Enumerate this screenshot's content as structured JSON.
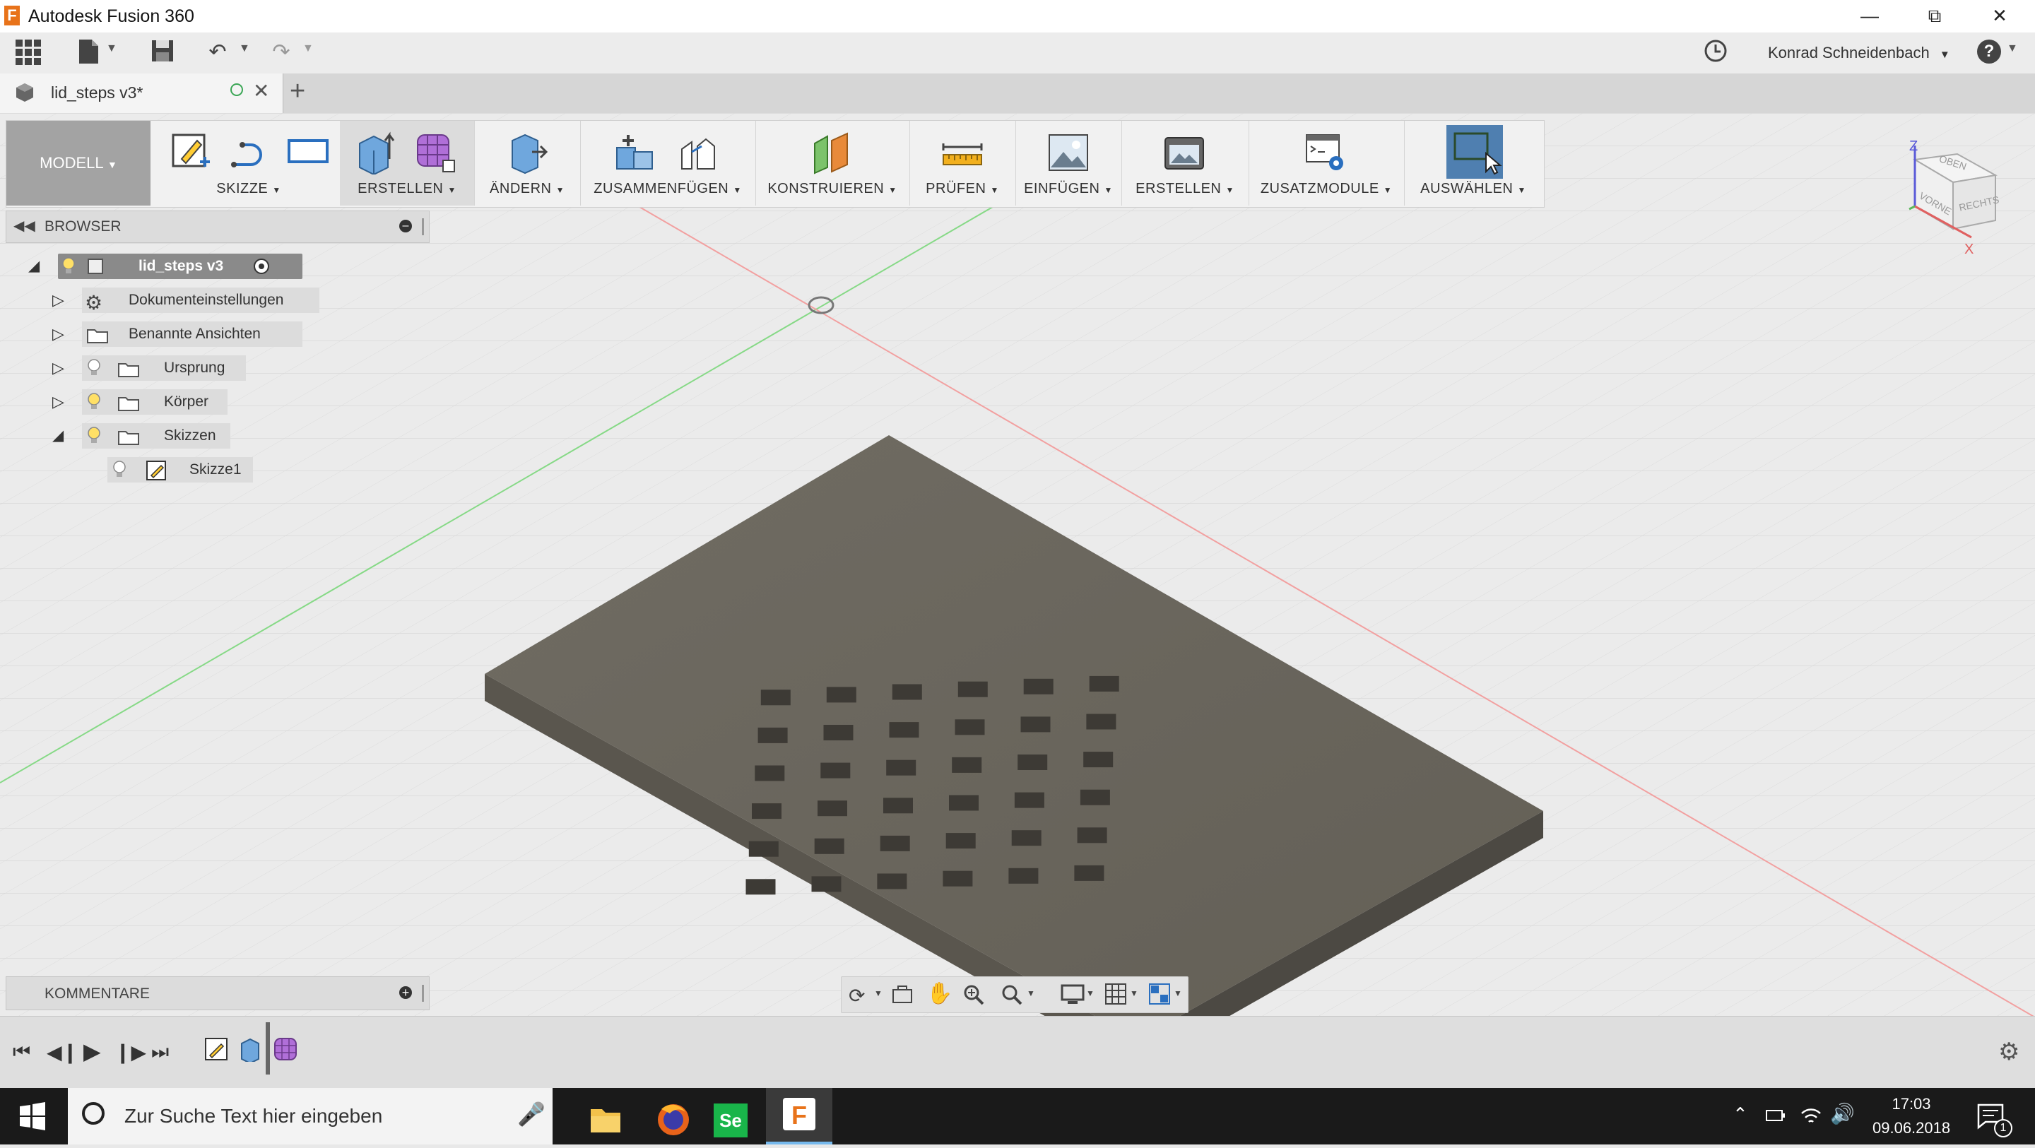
{
  "window": {
    "title": "Autodesk Fusion 360",
    "logo_letter": "F"
  },
  "account": {
    "user": "Konrad Schneidenbach"
  },
  "doc_tab": {
    "title": "lid_steps v3*"
  },
  "ribbon": {
    "workspace": "MODELL",
    "groups": [
      {
        "label": "SKIZZE"
      },
      {
        "label": "ERSTELLEN"
      },
      {
        "label": "ÄNDERN"
      },
      {
        "label": "ZUSAMMENFÜGEN"
      },
      {
        "label": "KONSTRUIEREN"
      },
      {
        "label": "PRÜFEN"
      },
      {
        "label": "EINFÜGEN"
      },
      {
        "label": "ERSTELLEN"
      },
      {
        "label": "ZUSATZMODULE"
      },
      {
        "label": "AUSWÄHLEN"
      }
    ]
  },
  "browser": {
    "title": "BROWSER",
    "root": "lid_steps v3",
    "items": [
      {
        "label": "Dokumenteinstellungen"
      },
      {
        "label": "Benannte Ansichten"
      },
      {
        "label": "Ursprung"
      },
      {
        "label": "Körper"
      },
      {
        "label": "Skizzen"
      },
      {
        "label": "Skizze1"
      }
    ]
  },
  "comments": {
    "title": "KOMMENTARE"
  },
  "viewcube": {
    "top": "OBEN",
    "front": "VORNE",
    "right": "RECHTS",
    "axis_z": "Z",
    "axis_x": "X"
  },
  "taskbar": {
    "search_placeholder": "Zur Suche Text hier eingeben",
    "time": "17:03",
    "date": "09.06.2018",
    "notification_count": "1"
  },
  "colors": {
    "body": "#6b675e",
    "body_side": "#57544c",
    "ribbon_active": "#4f7fb0",
    "workspace_btn": "#a3a3a3"
  }
}
